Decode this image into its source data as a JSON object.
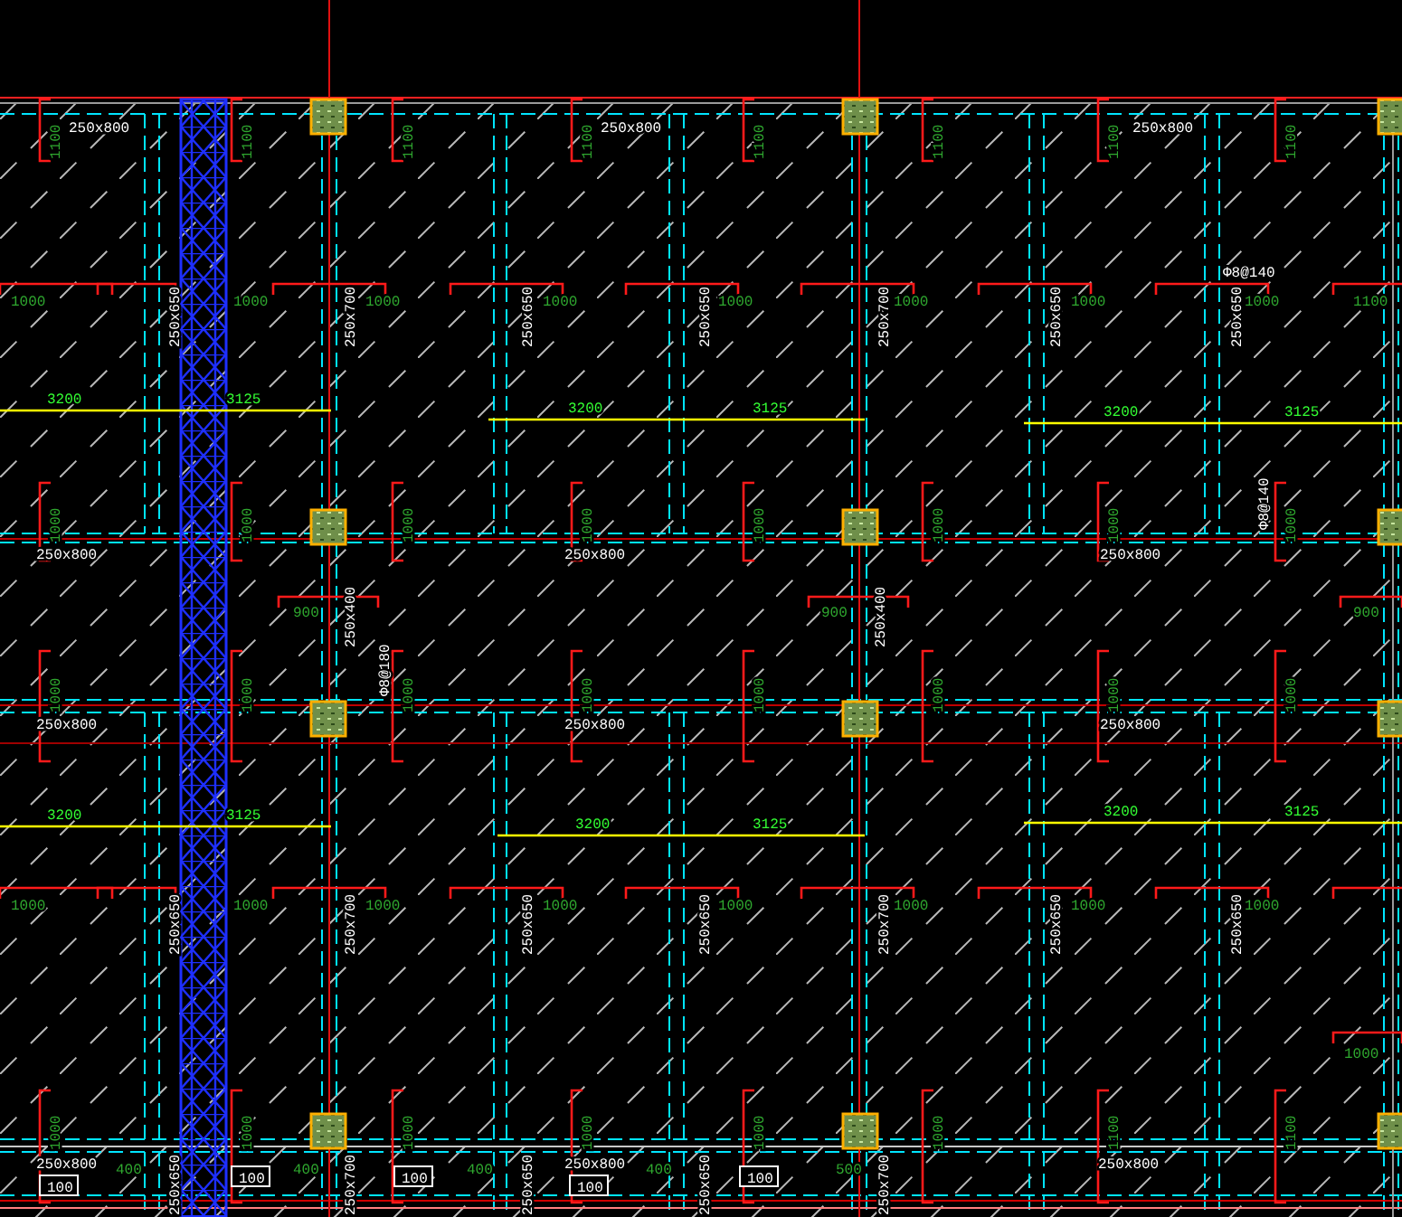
{
  "drawing": {
    "beam_labels": [
      "250x800",
      "250x800",
      "250x800",
      "250x800",
      "250x800",
      "250x800",
      "250x800",
      "250x800",
      "250x800",
      "250x800",
      "250x800",
      "250x800"
    ],
    "section_labels": [
      "250x650",
      "250x700",
      "250x650",
      "250x650",
      "250x700",
      "250x650",
      "250x650",
      "250x650",
      "250x700",
      "250x650",
      "250x650",
      "250x700",
      "250x650",
      "250x650",
      "250x650",
      "250x700",
      "250x650",
      "250x650",
      "250x700",
      "250x400",
      "250x400"
    ],
    "rebar_labels": [
      "Φ8@140",
      "Φ8@140",
      "Φ8@180"
    ],
    "top_support_lengths": [
      "1100",
      "1100",
      "1100",
      "1100",
      "1100",
      "1100",
      "1100",
      "1100"
    ],
    "upper_support_lengths": [
      "1000",
      "1000",
      "1000",
      "1000",
      "1000",
      "1000",
      "1000",
      "1000"
    ],
    "lower_support_lengths": [
      "1000",
      "1000",
      "1000",
      "1000",
      "1000",
      "1000",
      "1000",
      "1000"
    ],
    "bottom_support_lengths": [
      "1000",
      "1000",
      "1000",
      "1000",
      "1000",
      "1000",
      "1100",
      "1100"
    ],
    "row1_support_lengths": [
      "1000",
      "1000",
      "1000",
      "1000",
      "1000",
      "1000",
      "1000",
      "1000",
      "1100"
    ],
    "middle_support_lengths": [
      "900",
      "900",
      "900"
    ],
    "row3_support_lengths": [
      "1000",
      "1000",
      "1000",
      "1000",
      "1000",
      "1000",
      "1000",
      "1000",
      "1000"
    ],
    "span_lengths": [
      "3200",
      "3125",
      "3200",
      "3125",
      "3200",
      "3125",
      "3200",
      "3125",
      "3200",
      "3125",
      "3200",
      "3125"
    ],
    "edge_lengths": [
      "400",
      "400",
      "400",
      "400",
      "500"
    ],
    "slab_thickness": [
      "100",
      "100",
      "100",
      "100",
      "100"
    ]
  }
}
